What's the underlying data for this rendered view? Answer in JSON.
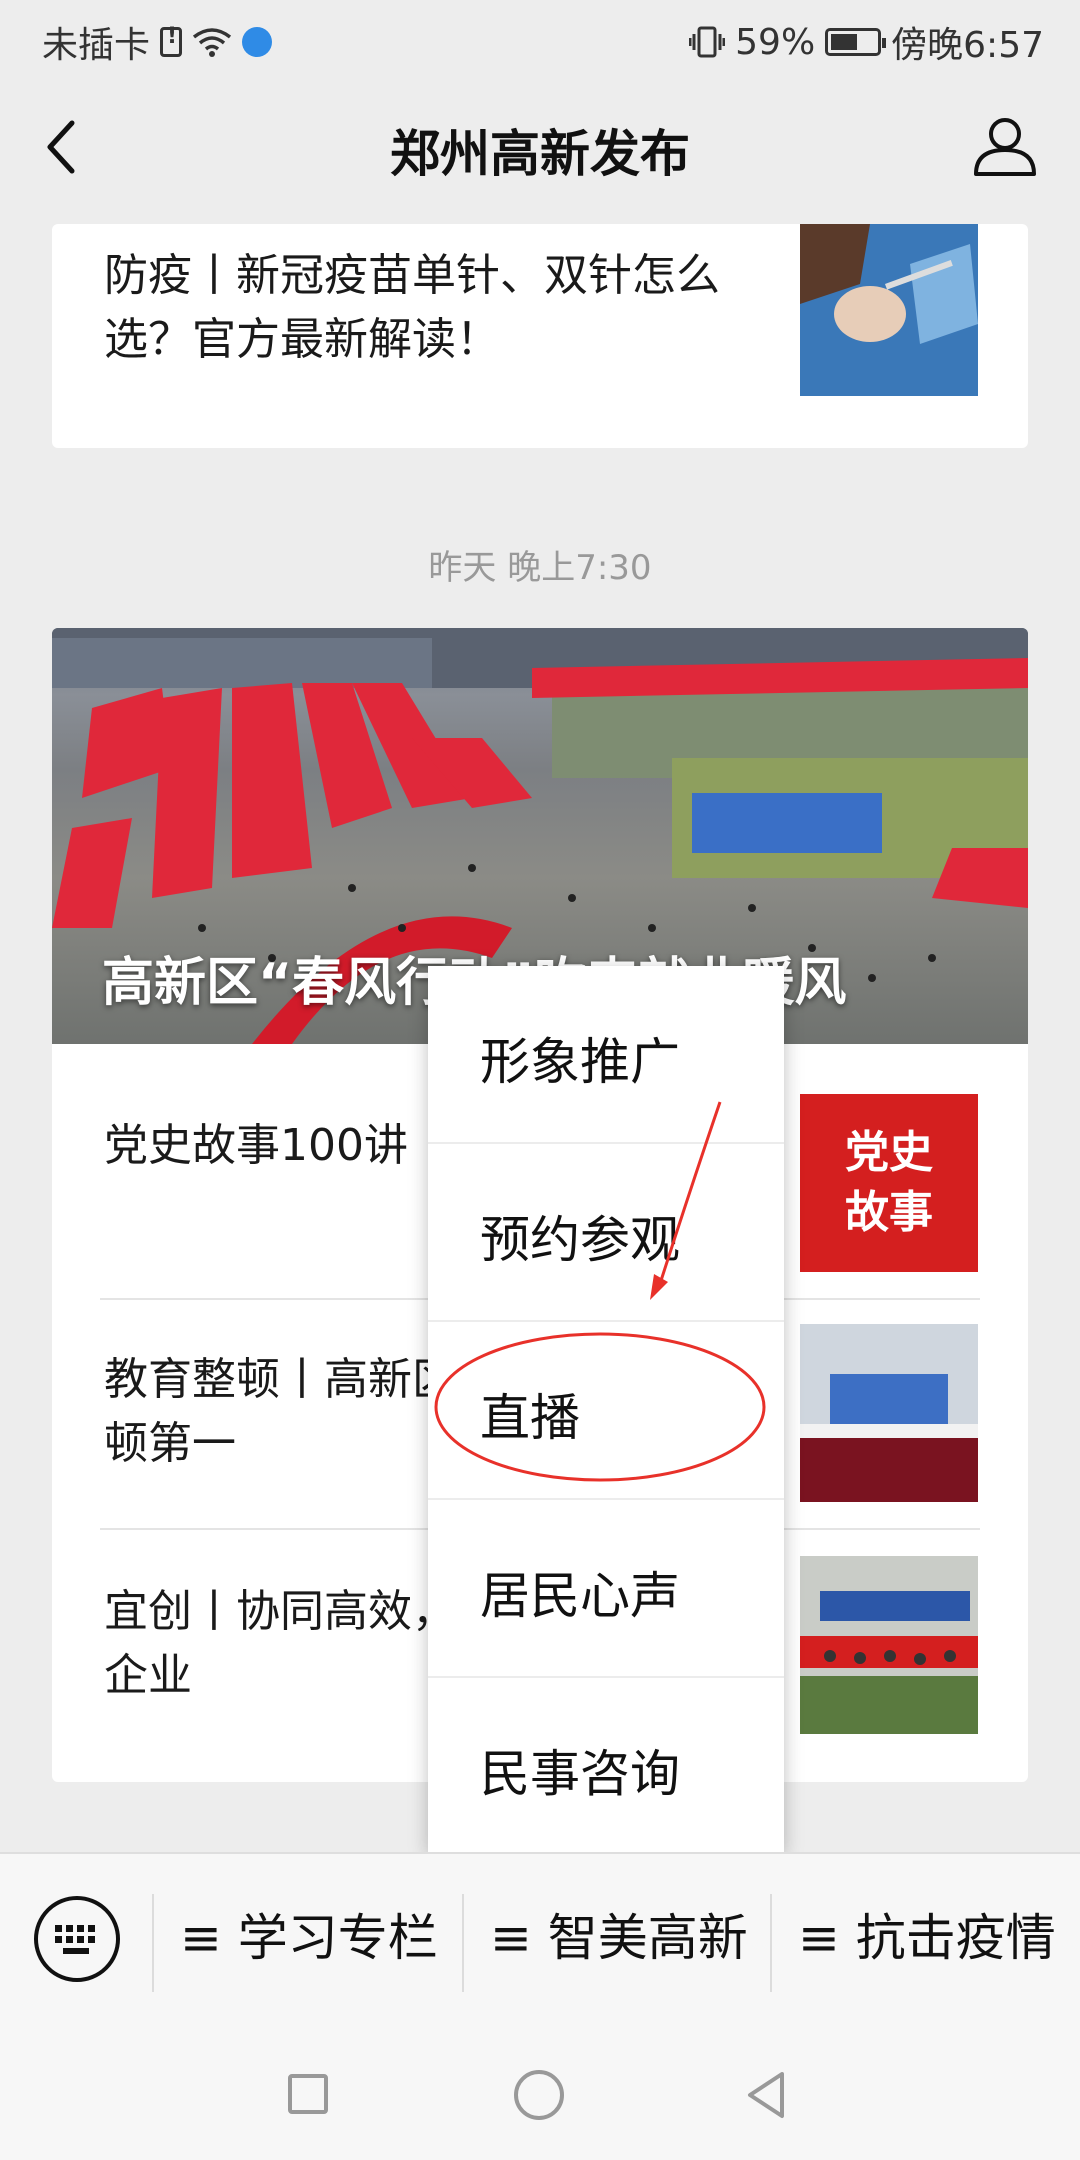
{
  "status_bar": {
    "carrier": "未插卡",
    "battery": "59%",
    "time": "傍晚6:57"
  },
  "nav": {
    "title": "郑州高新发布"
  },
  "top_article": {
    "title": "防疫丨新冠疫苗单针、双针怎么选？官方最新解读！"
  },
  "timestamp": "昨天 晚上7:30",
  "feature": {
    "hero_title": "高新区“春风行动”吹来就业暖风"
  },
  "articles": [
    {
      "title": "党史故事100讲（十）：百团大战",
      "thumb_text": "党史\n故事"
    },
    {
      "title": "教育整顿丨高新区政法队伍教育整顿第一",
      "thumb_text": ""
    },
    {
      "title": "宜创丨协同高效，高新区组织辖区企业",
      "thumb_text": ""
    }
  ],
  "menu": {
    "items": [
      "形象推广",
      "预约参观",
      "直播",
      "居民心声",
      "民事咨询"
    ]
  },
  "bottom_tabs": [
    {
      "label": "≡ 学习专栏"
    },
    {
      "label": "≡ 智美高新"
    },
    {
      "label": "≡ 抗击疫情"
    }
  ],
  "colors": {
    "annotation": "#e8312a",
    "accent_red": "#d41f1f"
  },
  "battery_level": 0.59
}
